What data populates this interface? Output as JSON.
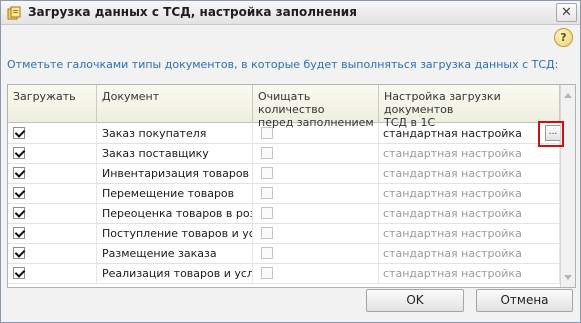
{
  "window": {
    "title": "Загрузка данных с ТСД, настройка заполнения",
    "close_glyph": "✕",
    "help_glyph": "?"
  },
  "instruction": "Отметьте галочками типы документов, в которые будет выполняться загрузка данных с ТСД:",
  "table": {
    "headers": {
      "load": "Загружать",
      "document": "Документ",
      "clear_line1": "Очищать количество",
      "clear_line2": "перед заполнением",
      "setting_line1": "Настройка загрузки документов",
      "setting_line2": "ТСД в 1С"
    },
    "rows": [
      {
        "checked": true,
        "document": "Заказ покупателя",
        "setting": "стандартная настройка"
      },
      {
        "checked": true,
        "document": "Заказ поставщику",
        "setting": "стандартная настройка"
      },
      {
        "checked": true,
        "document": "Инвентаризация товаров н...",
        "setting": "стандартная настройка"
      },
      {
        "checked": true,
        "document": "Перемещение товаров",
        "setting": "стандартная настройка"
      },
      {
        "checked": true,
        "document": "Переоценка товаров в роз...",
        "setting": "стандартная настройка"
      },
      {
        "checked": true,
        "document": "Поступление товаров и ус...",
        "setting": "стандартная настройка"
      },
      {
        "checked": true,
        "document": "Размещение заказа",
        "setting": "стандартная настройка"
      },
      {
        "checked": true,
        "document": "Реализация товаров и услуг",
        "setting": "стандартная настройка"
      }
    ],
    "ellipsis_label": "...",
    "selected_row_index": 0
  },
  "buttons": {
    "ok": "OK",
    "cancel": "Отмена"
  },
  "colors": {
    "instruction_text": "#2c6fb3",
    "highlight_border": "#d01010"
  }
}
